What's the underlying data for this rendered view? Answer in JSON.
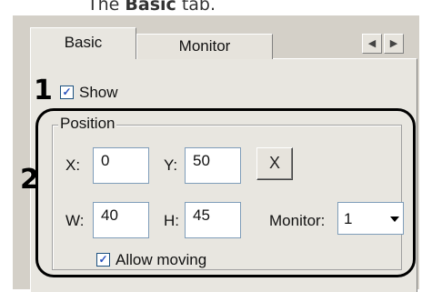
{
  "caption": {
    "prefix": "The ",
    "bold": "Basic",
    "suffix": " tab."
  },
  "tabs": [
    {
      "label": "Basic",
      "active": true
    },
    {
      "label": "Monitor",
      "active": false
    }
  ],
  "tab_scroll": {
    "left": "◀",
    "right": "▶"
  },
  "annotations": {
    "one": "1",
    "two": "2"
  },
  "show": {
    "label": "Show",
    "checked": true,
    "check_glyph": "✓"
  },
  "position": {
    "group_label": "Position",
    "x": {
      "label": "X:",
      "value": "0"
    },
    "y": {
      "label": "Y:",
      "value": "50"
    },
    "reset_button": "X",
    "w": {
      "label": "W:",
      "value": "40"
    },
    "h": {
      "label": "H:",
      "value": "45"
    },
    "monitor": {
      "label": "Monitor:",
      "value": "1"
    },
    "allow_moving": {
      "label": "Allow moving",
      "checked": true,
      "check_glyph": "✓"
    }
  }
}
